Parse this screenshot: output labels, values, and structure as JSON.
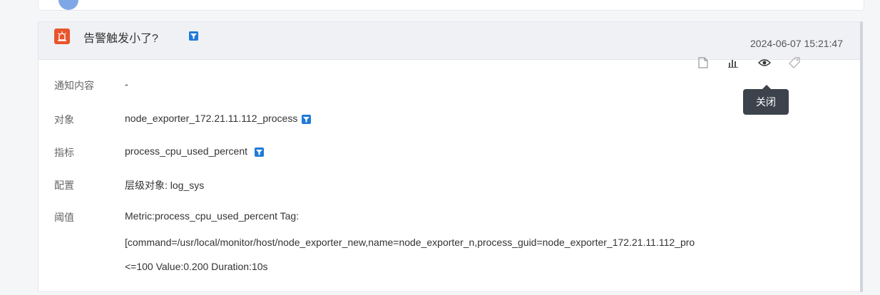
{
  "alert": {
    "title": "告警触发小了?",
    "time": "2024-06-07 15:21:47",
    "colors": {
      "alarm_icon": "#e8552d",
      "filter_icon": "#1f7ad8",
      "tooltip_bg": "#3c434d"
    },
    "rows": {
      "notify": {
        "label": "通知内容",
        "value": "-"
      },
      "object": {
        "label": "对象",
        "value": "node_exporter_172.21.11.112_process"
      },
      "metric": {
        "label": "指标",
        "value": "process_cpu_used_percent"
      },
      "config": {
        "label": "配置",
        "value": "层级对象: log_sys"
      },
      "threshold": {
        "label": "阈值",
        "line1": "Metric:process_cpu_used_percent Tag:",
        "line2": "[command=/usr/local/monitor/host/node_exporter_new,name=node_exporter_n,process_guid=node_exporter_172.21.11.112_pro",
        "line3": "<=100 Value:0.200 Duration:10s"
      }
    },
    "actions": {
      "icons": [
        "document-icon",
        "bar-chart-icon",
        "eye-icon",
        "tag-icon"
      ],
      "tooltip": "关闭"
    }
  }
}
